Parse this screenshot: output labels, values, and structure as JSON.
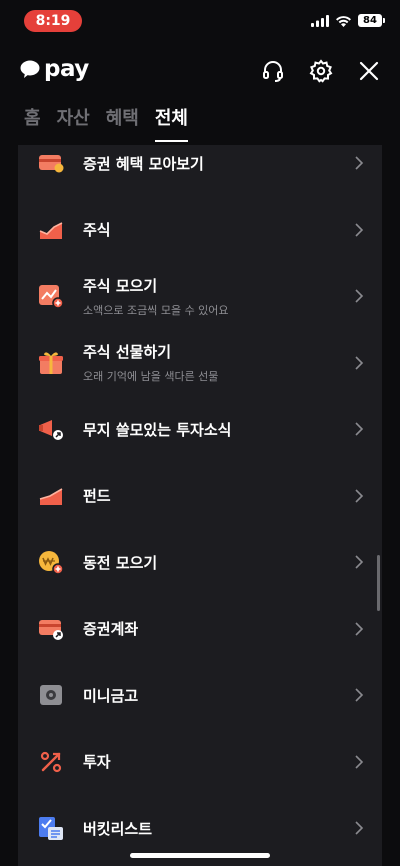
{
  "status": {
    "time": "8:19",
    "battery": "84"
  },
  "header": {
    "brand": "pay"
  },
  "tabs": [
    "홈",
    "자산",
    "혜택",
    "전체"
  ],
  "active_tab": "전체",
  "menu": [
    {
      "label": "증권 혜택 모아보기",
      "sub": "",
      "icon": "card-gift-icon"
    },
    {
      "label": "주식",
      "sub": "",
      "icon": "stock-chart-icon"
    },
    {
      "label": "주식 모으기",
      "sub": "소액으로 조금씩 모을 수 있어요",
      "icon": "stock-collect-icon"
    },
    {
      "label": "주식 선물하기",
      "sub": "오래 기억에 남을 색다른 선물",
      "icon": "gift-box-icon"
    },
    {
      "label": "무지 쓸모있는 투자소식",
      "sub": "",
      "icon": "megaphone-icon"
    },
    {
      "label": "펀드",
      "sub": "",
      "icon": "fund-chart-icon"
    },
    {
      "label": "동전 모으기",
      "sub": "",
      "icon": "coin-icon"
    },
    {
      "label": "증권계좌",
      "sub": "",
      "icon": "account-card-icon"
    },
    {
      "label": "미니금고",
      "sub": "",
      "icon": "safe-icon"
    },
    {
      "label": "투자",
      "sub": "",
      "icon": "percent-icon"
    },
    {
      "label": "버킷리스트",
      "sub": "",
      "icon": "checklist-icon"
    }
  ],
  "colors": {
    "accent": "#f0604a",
    "background": "#0c0c0e",
    "card": "#1c1c20",
    "status_pill": "#e5403a"
  }
}
